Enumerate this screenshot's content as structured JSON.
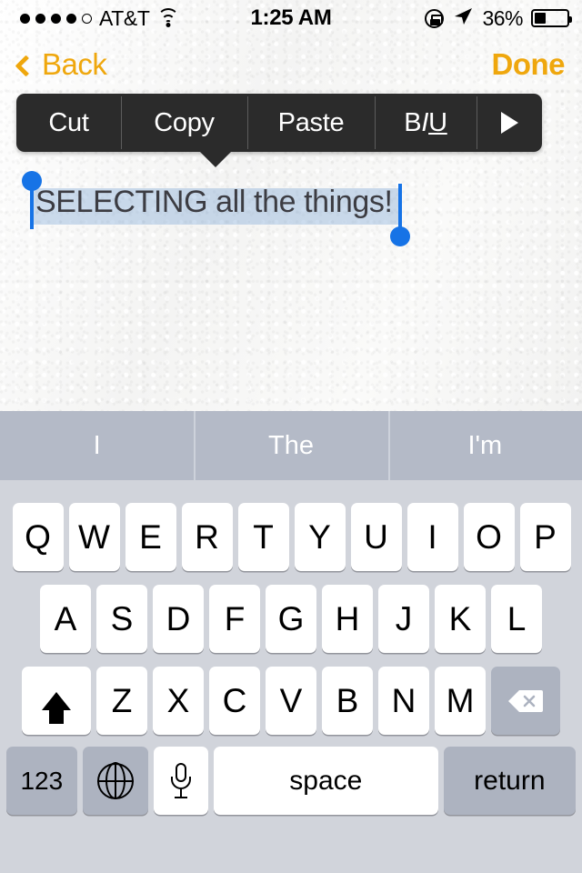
{
  "status_bar": {
    "signal_dots_filled": 4,
    "signal_dots_total": 5,
    "carrier": "AT&T",
    "wifi_icon": "wifi-icon",
    "time": "1:25 AM",
    "rotation_lock_icon": "rotation-lock-icon",
    "location_icon": "location-arrow-icon",
    "battery_percent": "36%",
    "battery_level": 36
  },
  "nav_bar": {
    "back_label": "Back",
    "back_chevron_icon": "chevron-left-icon",
    "done_label": "Done",
    "accent_color": "#EFA70D"
  },
  "edit_menu": {
    "background_color": "#2b2b2b",
    "items": [
      {
        "label": "Cut",
        "name": "cut"
      },
      {
        "label": "Copy",
        "name": "copy"
      },
      {
        "label": "Paste",
        "name": "paste"
      },
      {
        "label": "BIU",
        "name": "format"
      },
      {
        "label": "",
        "name": "more"
      }
    ],
    "format_b": "B",
    "format_i": "I",
    "format_u": "U",
    "more_icon": "triangle-right-icon"
  },
  "editor": {
    "text": "SELECTING all the things!",
    "selection_color": "#709ED0",
    "handle_color": "#1673E6",
    "text_color": "#3C3C42"
  },
  "keyboard": {
    "background_color": "#D1D4DB",
    "suggestion_bar_color": "#B4BAC7",
    "suggestions": [
      "I",
      "The",
      "I'm"
    ],
    "row1": [
      "Q",
      "W",
      "E",
      "R",
      "T",
      "Y",
      "U",
      "I",
      "O",
      "P"
    ],
    "row2": [
      "A",
      "S",
      "D",
      "F",
      "G",
      "H",
      "J",
      "K",
      "L"
    ],
    "row3": [
      "Z",
      "X",
      "C",
      "V",
      "B",
      "N",
      "M"
    ],
    "shift_icon": "shift-arrow-icon",
    "delete_icon": "backspace-icon",
    "numbers_label": "123",
    "globe_icon": "globe-icon",
    "mic_icon": "microphone-icon",
    "space_label": "space",
    "return_label": "return"
  }
}
